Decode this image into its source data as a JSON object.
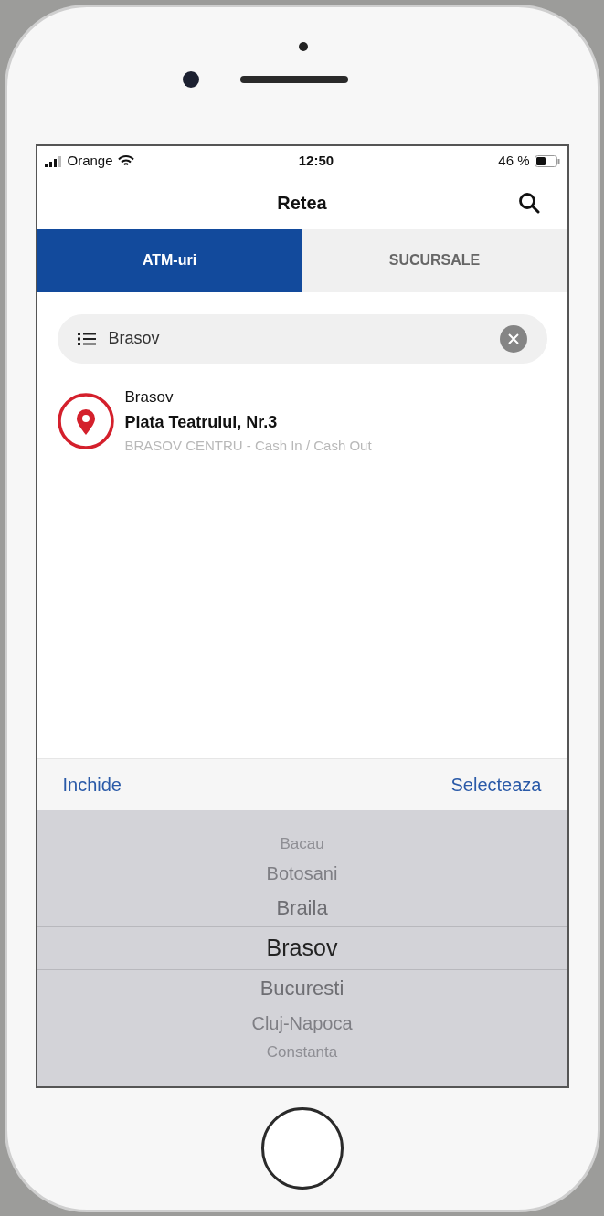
{
  "status_bar": {
    "carrier": "Orange",
    "time": "12:50",
    "battery": "46 %"
  },
  "nav": {
    "title": "Retea"
  },
  "tabs": [
    {
      "label": "ATM-uri",
      "selected": true
    },
    {
      "label": "SUCURSALE",
      "selected": false
    }
  ],
  "search": {
    "value": "Brasov"
  },
  "results": [
    {
      "city": "Brasov",
      "address": "Piata Teatrului, Nr.3",
      "description": "BRASOV CENTRU - Cash In / Cash Out"
    }
  ],
  "picker_toolbar": {
    "left": "Inchide",
    "right": "Selecteaza"
  },
  "picker": [
    {
      "label": "Bacau",
      "selected": false
    },
    {
      "label": "Botosani",
      "selected": false
    },
    {
      "label": "Braila",
      "selected": false
    },
    {
      "label": "Brasov",
      "selected": true
    },
    {
      "label": "Bucuresti",
      "selected": false
    },
    {
      "label": "Cluj-Napoca",
      "selected": false
    },
    {
      "label": "Constanta",
      "selected": false
    }
  ]
}
